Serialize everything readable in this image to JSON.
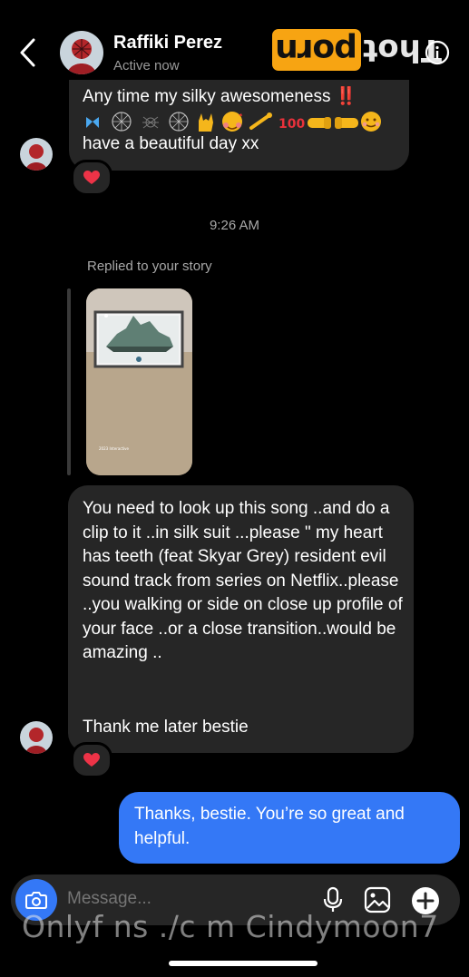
{
  "header": {
    "contact_name": "Raffiki Perez",
    "status": "Active now",
    "back_icon": "chevron-left-icon",
    "info_icon": "info-icon"
  },
  "watermark": {
    "badge_text": "porn",
    "text": "Thot",
    "badge_color": "#f7a412",
    "footer_text": "Onlyf ns ./c m Cindymoon7"
  },
  "messages": {
    "first": {
      "line1": "Any time my silky awesomeness ‼️",
      "emoji_line": "🦋🕸️🕷️🕸️🤟🥰💫💯🤜🤛😊",
      "line3": "have a beautiful day xx",
      "reaction": "❤️"
    },
    "timestamp": "9:26 AM",
    "story_reply_label": "Replied to your story",
    "second": {
      "text": "You need to look up this song ..and do a clip to it ..in silk suit ...please \" my heart has teeth (feat Skyar Grey) resident evil sound track from series on Netflix..please ..you walking or side on close up profile of your face ..or a close transition..would be amazing ..",
      "thanks": "Thank me later bestie",
      "reaction": "❤️"
    },
    "outgoing": {
      "text": "Thanks, bestie. You’re so great and helpful."
    }
  },
  "composer": {
    "placeholder": "Message...",
    "camera_icon": "camera-icon",
    "mic_icon": "microphone-icon",
    "gallery_icon": "image-icon",
    "plus_icon": "plus-icon"
  },
  "colors": {
    "background": "#000000",
    "incoming_bubble": "#262626",
    "outgoing_bubble": "#3478f6",
    "secondary_text": "#a8a8a8"
  }
}
